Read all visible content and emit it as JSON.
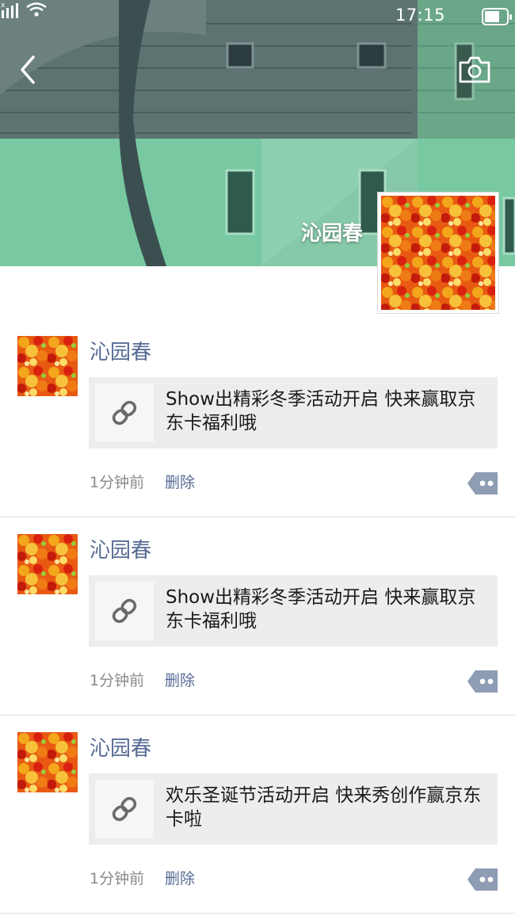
{
  "status_bar": {
    "time": "17:15"
  },
  "cover": {
    "name": "沁园春"
  },
  "icons": {
    "back": "back-arrow-icon",
    "camera": "camera-icon",
    "link": "link-icon",
    "comment": "comment-more-icon"
  },
  "colors": {
    "name_blue": "#576b95",
    "card_bg": "#ededed",
    "meta_gray": "#8a8a8a"
  },
  "posts": [
    {
      "author": "沁园春",
      "link_title": "Show出精彩冬季活动开启 快来赢取京东卡福利哦",
      "time": "1分钟前",
      "delete_label": "删除"
    },
    {
      "author": "沁园春",
      "link_title": "Show出精彩冬季活动开启 快来赢取京东卡福利哦",
      "time": "1分钟前",
      "delete_label": "删除"
    },
    {
      "author": "沁园春",
      "link_title": "欢乐圣诞节活动开启 快来秀创作赢京东卡啦",
      "time": "1分钟前",
      "delete_label": "删除"
    }
  ]
}
